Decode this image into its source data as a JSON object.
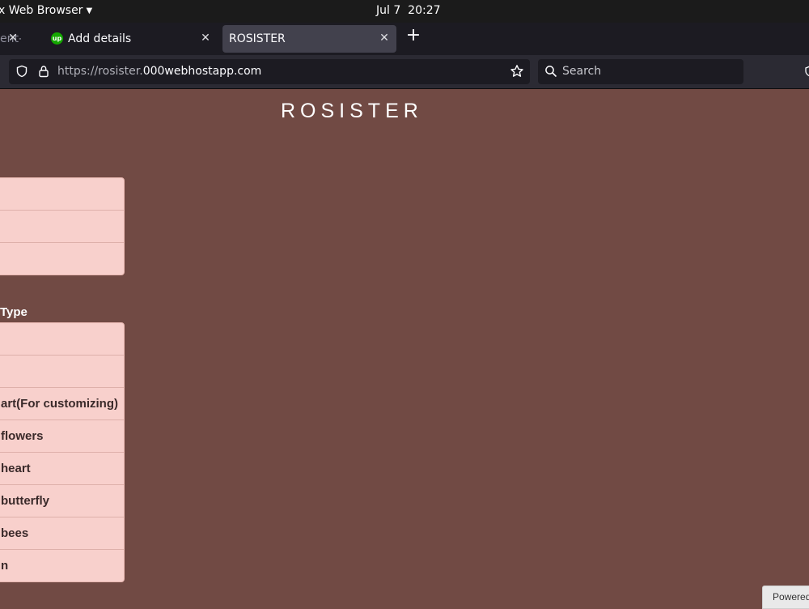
{
  "system_bar": {
    "app_menu_label": "x Web Browser",
    "date": "Jul 7",
    "time": "20:27"
  },
  "browser": {
    "tabs": [
      {
        "label": "ent-s",
        "active": false
      },
      {
        "label": "Add details",
        "favicon": "upwork-icon",
        "favicon_text": "up",
        "active": false
      },
      {
        "label": "ROSISTER",
        "active": true
      }
    ],
    "url": {
      "scheme_and_subdomain": "https://rosister.",
      "domain": "000webhostapp.com"
    },
    "search_placeholder": "Search"
  },
  "page": {
    "title": "ROSISTER",
    "list_group_1": {
      "items": [
        "",
        "",
        ""
      ]
    },
    "section_label": "Type",
    "list_group_2": {
      "items": [
        "",
        "",
        "art(For customizing)",
        "flowers",
        "heart",
        "butterfly",
        "bees",
        "n"
      ]
    },
    "footer_badge": "Powered"
  },
  "colors": {
    "page_background": "#714a44",
    "list_background": "#f8d0cc",
    "browser_chrome": "#1c1b22",
    "active_tab": "#42414d"
  }
}
